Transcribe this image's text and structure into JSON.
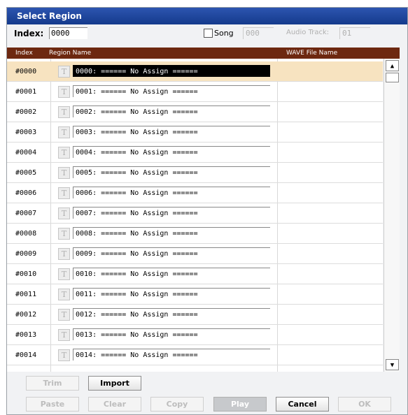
{
  "dialog": {
    "title": "Select Region"
  },
  "index_field": {
    "label": "Index:",
    "value": "0000"
  },
  "song": {
    "label": "Song",
    "value": "000",
    "checked": false
  },
  "audio_track": {
    "label": "Audio Track:",
    "value": "01"
  },
  "table": {
    "headers": {
      "index": "Index",
      "region_name": "Region Name",
      "wave_file": "WAVE File Name"
    },
    "selected_row": 0,
    "rows": [
      {
        "index": "#0000",
        "name": "0000: ====== No Assign ======",
        "wave": ""
      },
      {
        "index": "#0001",
        "name": "0001: ====== No Assign ======",
        "wave": ""
      },
      {
        "index": "#0002",
        "name": "0002: ====== No Assign ======",
        "wave": ""
      },
      {
        "index": "#0003",
        "name": "0003: ====== No Assign ======",
        "wave": ""
      },
      {
        "index": "#0004",
        "name": "0004: ====== No Assign ======",
        "wave": ""
      },
      {
        "index": "#0005",
        "name": "0005: ====== No Assign ======",
        "wave": ""
      },
      {
        "index": "#0006",
        "name": "0006: ====== No Assign ======",
        "wave": ""
      },
      {
        "index": "#0007",
        "name": "0007: ====== No Assign ======",
        "wave": ""
      },
      {
        "index": "#0008",
        "name": "0008: ====== No Assign ======",
        "wave": ""
      },
      {
        "index": "#0009",
        "name": "0009: ====== No Assign ======",
        "wave": ""
      },
      {
        "index": "#0010",
        "name": "0010: ====== No Assign ======",
        "wave": ""
      },
      {
        "index": "#0011",
        "name": "0011: ====== No Assign ======",
        "wave": ""
      },
      {
        "index": "#0012",
        "name": "0012: ====== No Assign ======",
        "wave": ""
      },
      {
        "index": "#0013",
        "name": "0013: ====== No Assign ======",
        "wave": ""
      },
      {
        "index": "#0014",
        "name": "0014: ====== No Assign ======",
        "wave": ""
      }
    ],
    "text_button_glyph": "T"
  },
  "scroll": {
    "up_glyph": "▲",
    "down_glyph": "▼"
  },
  "buttons": {
    "trim": "Trim",
    "import": "Import",
    "paste": "Paste",
    "clear": "Clear",
    "copy": "Copy",
    "play": "Play",
    "cancel": "Cancel",
    "ok": "OK"
  },
  "colors": {
    "title_bar": "#143a8c",
    "header_bar": "#6d2810",
    "selected_row": "#f7e3c0"
  }
}
